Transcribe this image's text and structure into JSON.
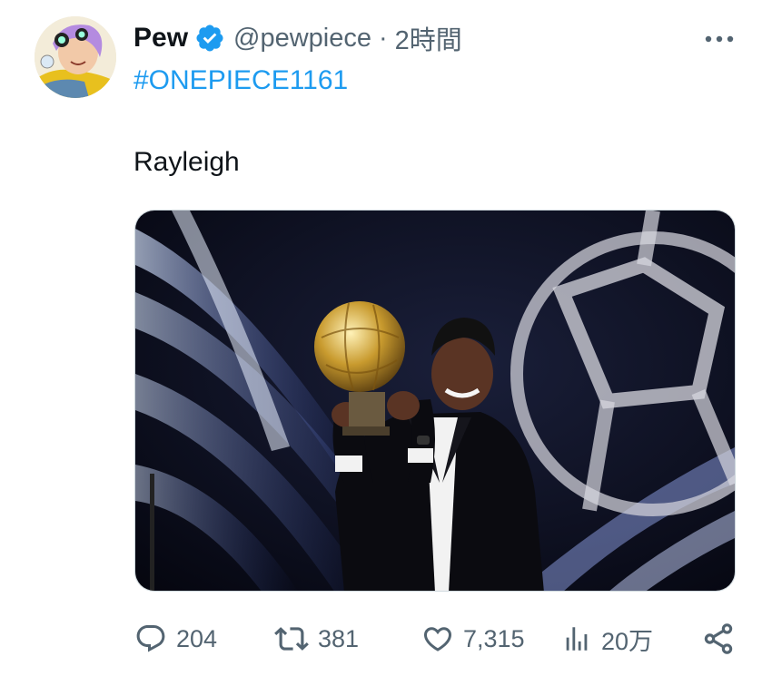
{
  "tweet": {
    "author": {
      "display_name": "Pew",
      "verified": true,
      "handle": "@pewpiece",
      "avatar_icon": "avatar-anime-character"
    },
    "separator": "·",
    "timestamp": "2時間",
    "hashtag": "#ONEPIECE1161",
    "text": "Rayleigh",
    "media": {
      "description_icon": "photo-trophy-ceremony"
    },
    "actions": {
      "reply": {
        "icon": "reply-icon",
        "count": "204"
      },
      "retweet": {
        "icon": "retweet-icon",
        "count": "381"
      },
      "like": {
        "icon": "heart-icon",
        "count": "7,315"
      },
      "views": {
        "icon": "views-chart-icon",
        "count": "20万"
      },
      "share": {
        "icon": "share-icon"
      }
    }
  },
  "colors": {
    "text_primary": "#0f1419",
    "text_secondary": "#536471",
    "accent": "#1d9bf0",
    "border": "#cfd9de"
  }
}
